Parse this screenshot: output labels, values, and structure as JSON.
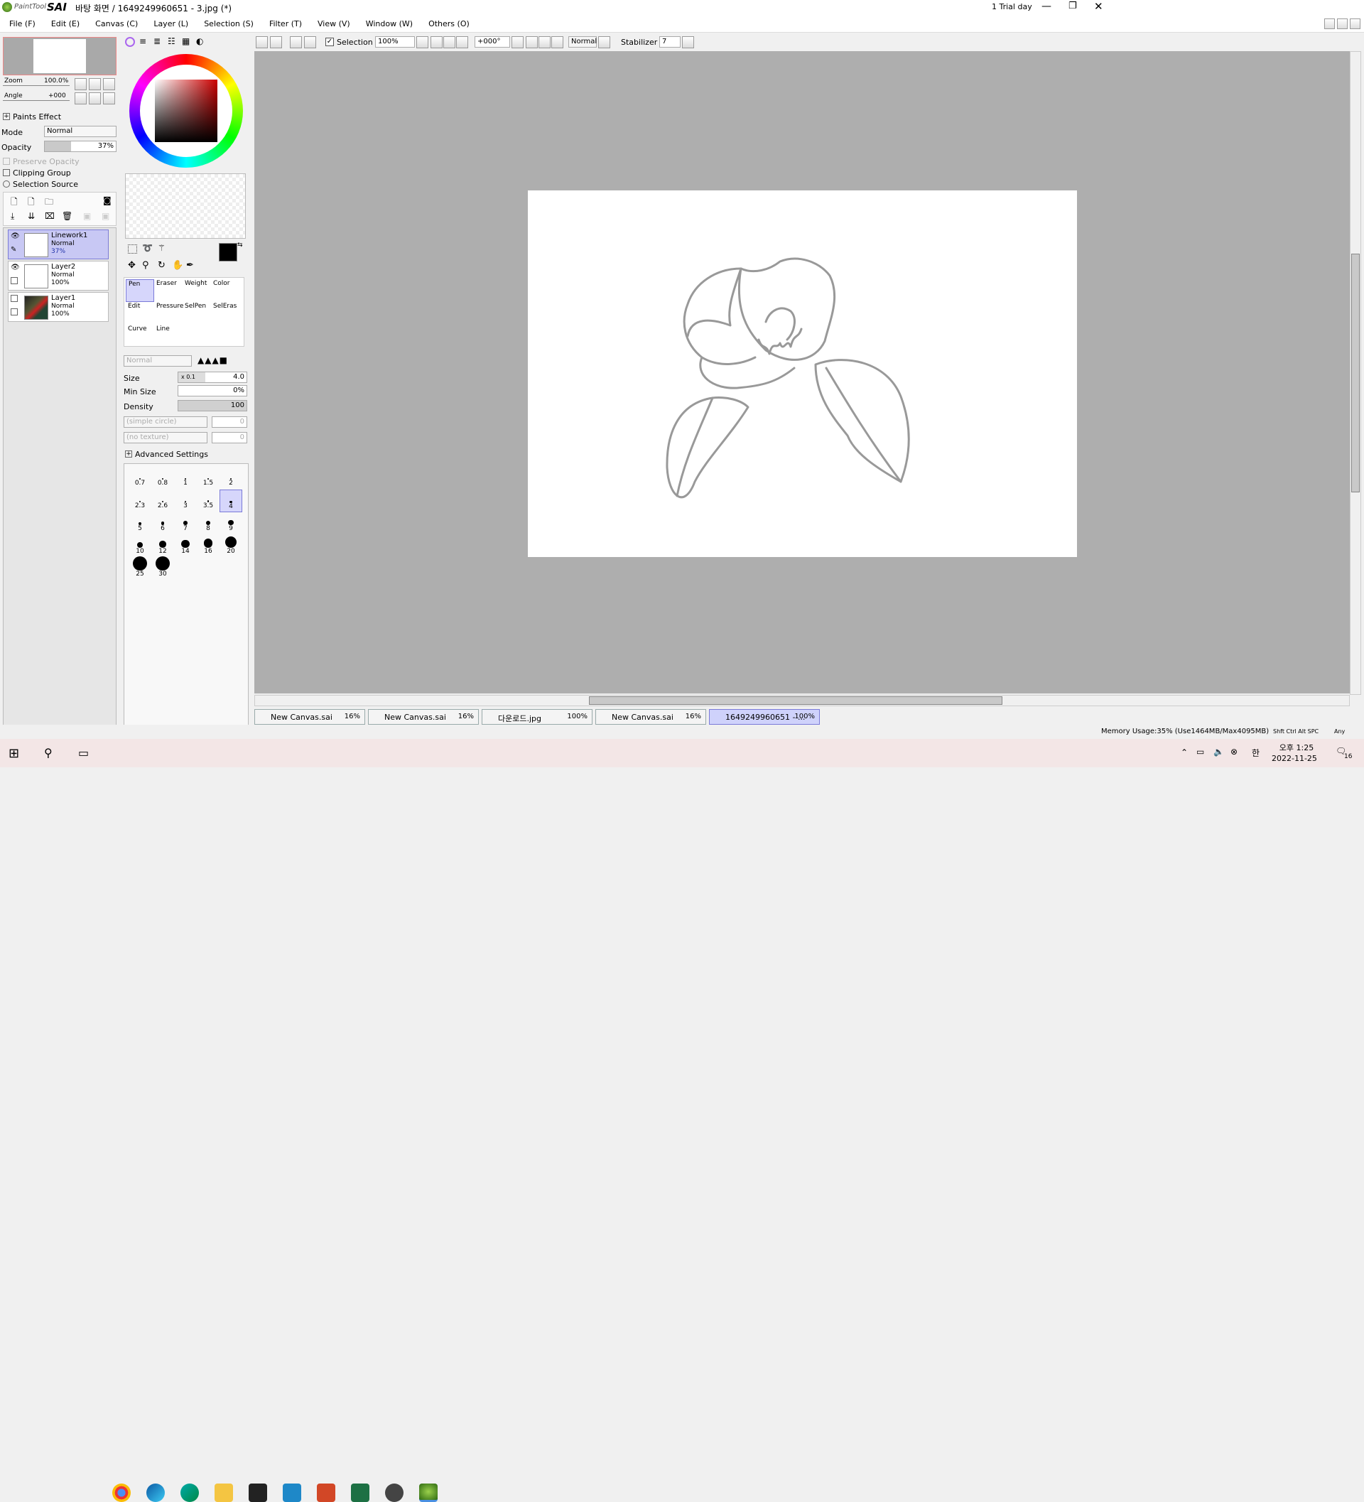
{
  "titlebar": {
    "app_name": "SAI",
    "app_prefix": "PaintTool",
    "doc_title": "바탕 화면 / 1649249960651 - 3.jpg (*)",
    "trial": "1 Trial day"
  },
  "menu": [
    "File (F)",
    "Edit (E)",
    "Canvas (C)",
    "Layer (L)",
    "Selection (S)",
    "Filter (T)",
    "View (V)",
    "Window (W)",
    "Others (O)"
  ],
  "navigator": {
    "zoom_label": "Zoom",
    "zoom_value": "100.0%",
    "angle_label": "Angle",
    "angle_value": "+000"
  },
  "layer_panel": {
    "paints_effect": "Paints Effect",
    "mode_label": "Mode",
    "mode_value": "Normal",
    "opacity_label": "Opacity",
    "opacity_value": "37%",
    "opacity_fraction": 0.37,
    "preserve_opacity": "Preserve Opacity",
    "clipping_group": "Clipping Group",
    "selection_source": "Selection Source",
    "layers": [
      {
        "name": "Linework1",
        "mode": "Normal",
        "opacity": "37%"
      },
      {
        "name": "Layer2",
        "mode": "Normal",
        "opacity": "100%"
      },
      {
        "name": "Layer1",
        "mode": "Normal",
        "opacity": "100%"
      }
    ]
  },
  "tools": {
    "pen": "Pen",
    "eraser": "Eraser",
    "weight": "Weight",
    "color": "Color",
    "edit": "Edit",
    "pressure": "Pressure",
    "selpen": "SelPen",
    "seleras": "SelEras",
    "curve": "Curve",
    "line": "Line"
  },
  "brush_settings": {
    "blend_mode": "Normal",
    "size_label": "Size",
    "size_mult": "x 0.1",
    "size_value": "4.0",
    "min_size_label": "Min Size",
    "min_size_value": "0%",
    "density_label": "Density",
    "density_value": "100",
    "shape": "(simple circle)",
    "shape_value": "0",
    "texture": "(no texture)",
    "texture_value": "0",
    "advanced": "Advanced Settings"
  },
  "brush_sizes": [
    "0.7",
    "0.8",
    "1",
    "1.5",
    "2",
    "2.3",
    "2.6",
    "3",
    "3.5",
    "4",
    "5",
    "6",
    "7",
    "8",
    "9",
    "10",
    "12",
    "14",
    "16",
    "20",
    "25",
    "30"
  ],
  "toolbar": {
    "selection_label": "Selection",
    "zoom": "100%",
    "angle": "+000°",
    "blend": "Normal",
    "stabilizer_label": "Stabilizer",
    "stabilizer_value": "7"
  },
  "tabs": [
    {
      "name": "New Canvas.sai",
      "pct": "16%"
    },
    {
      "name": "New Canvas.sai",
      "pct": "16%"
    },
    {
      "name": "다운로드.jpg",
      "pct": "100%"
    },
    {
      "name": "New Canvas.sai",
      "pct": "16%"
    },
    {
      "name": "1649249960651 - ...",
      "pct": "100%"
    }
  ],
  "status": {
    "memory": "Memory Usage:35% (Use1464MB/Max4095MB)",
    "keys": "Shft Ctrl Alt SPC",
    "any": "Any"
  },
  "taskbar": {
    "time": "오후 1:25",
    "date": "2022-11-25",
    "ime": "한",
    "notif": "16"
  },
  "colors": {
    "primary": "#000000",
    "selected": "#c8c8f4",
    "canvas_bg": "#aeaeae"
  }
}
